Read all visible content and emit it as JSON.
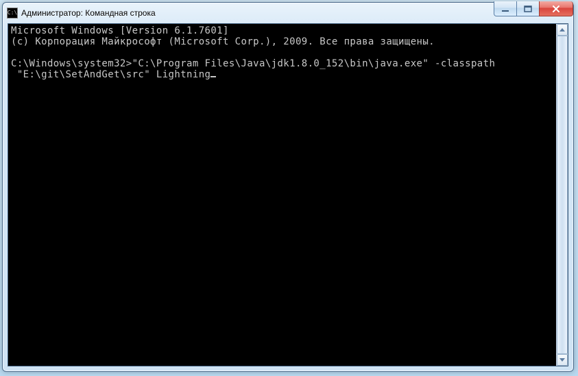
{
  "window": {
    "title": "Администратор: Командная строка",
    "icon_name": "cmd-icon",
    "colors": {
      "close_red": "#d8443c",
      "frame_blue": "#cfe3f4",
      "desktop_bg": "#b8d8ef"
    }
  },
  "terminal": {
    "lines": [
      "Microsoft Windows [Version 6.1.7601]",
      "(c) Корпорация Майкрософт (Microsoft Corp.), 2009. Все права защищены.",
      "",
      "C:\\Windows\\system32>\"C:\\Program Files\\Java\\jdk1.8.0_152\\bin\\java.exe\" -classpath",
      " \"E:\\git\\SetAndGet\\src\" Lightning"
    ]
  }
}
